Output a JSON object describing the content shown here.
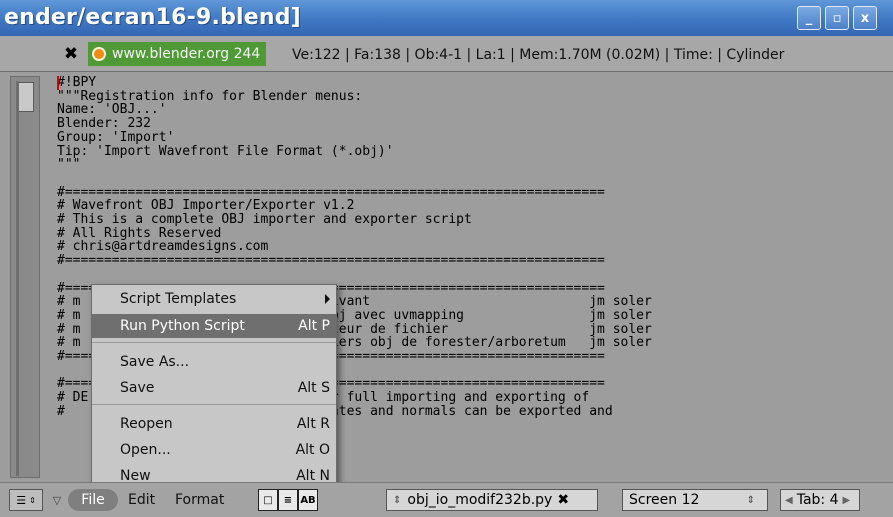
{
  "window": {
    "title": "ender/ecran16-9.blend]",
    "buttons": [
      "_",
      "▫",
      "x"
    ]
  },
  "info": {
    "close_symbol": "✖",
    "website": "www.blender.org 244",
    "stats": "Ve:122 | Fa:138 | Ob:4-1 | La:1  | Mem:1.70M (0.02M)  | Time: | Cylinder"
  },
  "editor": {
    "lines": [
      "#!BPY",
      "\"\"\"Registration info for Blender menus:",
      "Name: 'OBJ...'",
      "Blender: 232",
      "Group: 'Import'",
      "Tip: 'Import Wavefront File Format (*.obj)'",
      "\"\"\"",
      "",
      "#=====================================================================",
      "# Wavefront OBJ Importer/Exporter v1.2",
      "# This is a complete OBJ importer and exporter script",
      "# All Rights Reserved",
      "# chris@artdreamdesigns.com",
      "#=====================================================================",
      "",
      "#=====================================================================",
      "# m                         3 et suivant                            jm soler",
      "# m                         brush obj avec uvmapping                jm soler",
      "# m                         e selecteur de fichier                  jm soler",
      "# m                         es fichiers obj de forester/arboretum   jm soler",
      "#=====================================================================",
      "",
      "#=====================================================================",
      "# DE                        lows for full importing and exporting of",
      "#                           coordinates and normals can be exported and"
    ]
  },
  "menu": {
    "items": [
      {
        "label": "Script Templates",
        "shortcut": "",
        "submenu": true
      },
      {
        "label": "Run Python Script",
        "shortcut": "Alt P",
        "selected": true
      },
      {
        "label": "Save As...",
        "shortcut": ""
      },
      {
        "label": "Save",
        "shortcut": "Alt S"
      },
      {
        "label": "Reopen",
        "shortcut": "Alt R"
      },
      {
        "label": "Open...",
        "shortcut": "Alt O"
      },
      {
        "label": "New",
        "shortcut": "Alt N"
      }
    ]
  },
  "footer": {
    "file_menu": "File",
    "edit_menu": "Edit",
    "format_menu": "Format",
    "syntax_toggle": "AB",
    "script_name": "obj_io_modif232b.py",
    "script_close": "✖",
    "screen": "Screen 12",
    "tab": "Tab: 4"
  },
  "colors": {
    "title_bar": "#3f77c2",
    "website_tag": "#4f9a37",
    "menu_selected": "#6f6f6f",
    "cursor": "#d40000"
  }
}
